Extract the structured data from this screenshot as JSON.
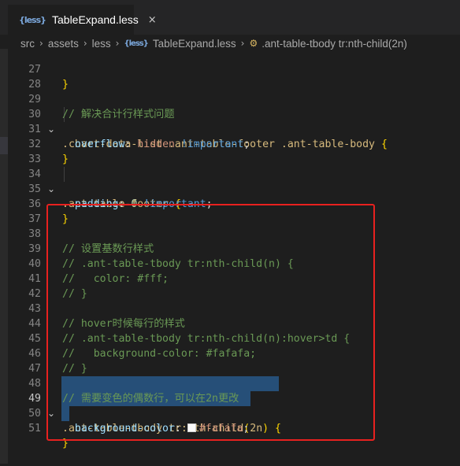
{
  "tab": {
    "file_icon": "less-file-icon",
    "label": "TableExpand.less",
    "close": "×"
  },
  "breadcrumb": {
    "items": [
      "src",
      "assets",
      "less",
      "TableExpand.less",
      ".ant-table-tbody tr:nth-child(2n)"
    ]
  },
  "lines": {
    "l27": {
      "num": "27",
      "text": "}"
    },
    "l28": {
      "num": "28"
    },
    "l29": {
      "num": "29",
      "text": "// 解决合计行样式问题"
    },
    "l30": {
      "num": "30",
      "text": ".chart-data-list .ant-table-footer .ant-table-body",
      "brace": "{"
    },
    "l31": {
      "num": "31",
      "prop": "overflow",
      "value": "hidden",
      "imp": "!important"
    },
    "l32": {
      "num": "32",
      "text": "}"
    },
    "l33": {
      "num": "33"
    },
    "l34": {
      "num": "34",
      "text": ".ant-table-footer",
      "brace": "{"
    },
    "l35": {
      "num": "35",
      "prop": "padding",
      "value": "0",
      "imp": "!important"
    },
    "l36": {
      "num": "36",
      "text": "}"
    },
    "l37": {
      "num": "37"
    },
    "l38": {
      "num": "38",
      "text": "// 设置基数行样式"
    },
    "l39": {
      "num": "39",
      "text": "// .ant-table-tbody tr:nth-child(n) {"
    },
    "l40": {
      "num": "40",
      "text": "//   color: #fff;"
    },
    "l41": {
      "num": "41",
      "text": "// }"
    },
    "l42": {
      "num": "42"
    },
    "l43": {
      "num": "43",
      "text": "// hover时候每行的样式"
    },
    "l44": {
      "num": "44",
      "text": "// .ant-table-tbody tr:nth-child(n):hover>td {"
    },
    "l45": {
      "num": "45",
      "text": "//   background-color: #fafafa;"
    },
    "l46": {
      "num": "46",
      "text": "// }"
    },
    "l47": {
      "num": "47"
    },
    "l48": {
      "num": "48",
      "text": "// 需要变色的偶数行，可以在2n更改"
    },
    "l49": {
      "num": "49",
      "sel1": ".ant-table-tbody",
      "sel2": "tr",
      "pseudo": ":nth-child",
      "arg_open": "(",
      "arg": "2n",
      "arg_close": ")",
      "brace": "{"
    },
    "l50": {
      "num": "50",
      "prop": "background-color",
      "value": "#fafafa"
    },
    "l51": {
      "num": "51",
      "text": "}"
    }
  },
  "colors": {
    "annotation_box": "#e8211f",
    "selection": "#264f78"
  }
}
